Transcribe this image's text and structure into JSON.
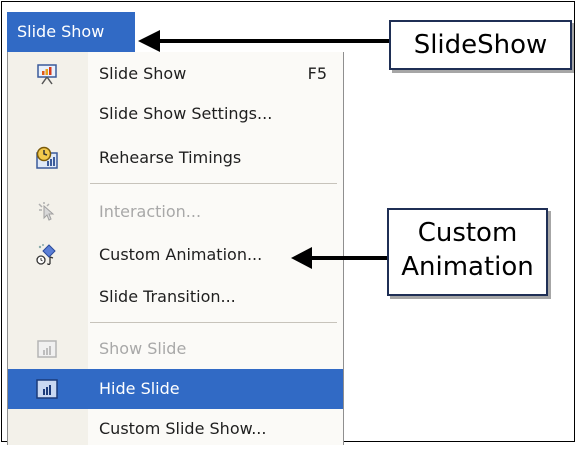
{
  "menu": {
    "title": "Slide Show",
    "items": [
      {
        "label": "Slide Show",
        "shortcut": "F5",
        "icon": "slide-show-icon",
        "state": "normal"
      },
      {
        "label": "Slide Show Settings...",
        "shortcut": "",
        "icon": "",
        "state": "normal"
      },
      {
        "label": "Rehearse Timings",
        "shortcut": "",
        "icon": "rehearse-timings-icon",
        "state": "normal"
      },
      {
        "label": "Interaction...",
        "shortcut": "",
        "icon": "interaction-icon",
        "state": "disabled"
      },
      {
        "label": "Custom Animation...",
        "shortcut": "",
        "icon": "custom-animation-icon",
        "state": "normal"
      },
      {
        "label": "Slide Transition...",
        "shortcut": "",
        "icon": "",
        "state": "normal"
      },
      {
        "label": "Show Slide",
        "shortcut": "",
        "icon": "show-slide-icon",
        "state": "disabled"
      },
      {
        "label": "Hide Slide",
        "shortcut": "",
        "icon": "hide-slide-icon",
        "state": "selected"
      },
      {
        "label": "Custom Slide Show...",
        "shortcut": "",
        "icon": "",
        "state": "normal"
      }
    ]
  },
  "callouts": {
    "slideshow": "SlideShow",
    "animation_line1": "Custom",
    "animation_line2": "Animation"
  },
  "colors": {
    "highlight": "#316ac5",
    "callout_border": "#1f2f55",
    "disabled_text": "#a8a8a8"
  }
}
